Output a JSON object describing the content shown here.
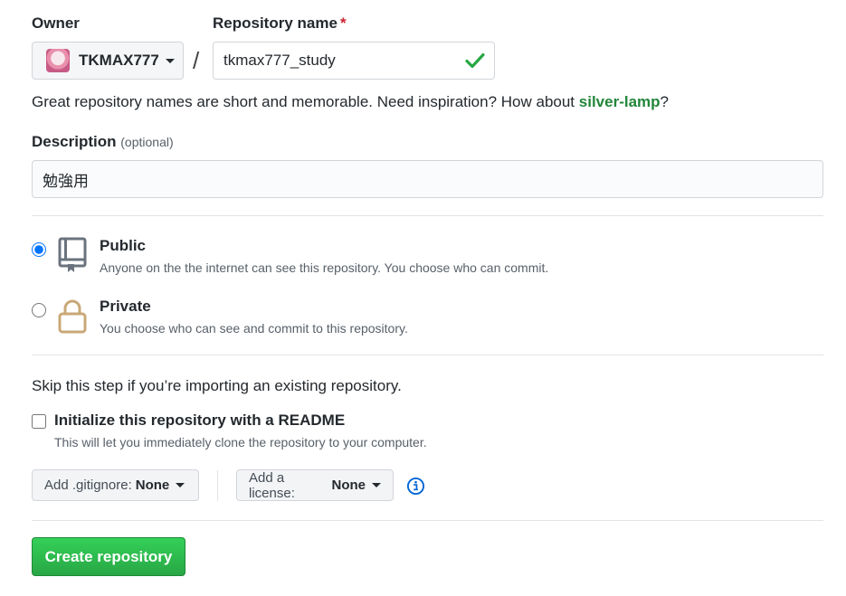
{
  "owner": {
    "label": "Owner",
    "value": "TKMAX777"
  },
  "separator": "/",
  "repo_name": {
    "label": "Repository name",
    "required_mark": "*",
    "value": "tkmax777_study"
  },
  "name_hint": {
    "prefix": "Great repository names are short and memorable. Need inspiration? How about ",
    "suggestion": "silver-lamp",
    "suffix": "?"
  },
  "description": {
    "label": "Description",
    "optional": "(optional)",
    "value": "勉強用"
  },
  "visibility": {
    "public": {
      "title": "Public",
      "desc": "Anyone on the the internet can see this repository. You choose who can commit."
    },
    "private": {
      "title": "Private",
      "desc": "You choose who can see and commit to this repository."
    },
    "selected": "public"
  },
  "skip_note": "Skip this step if you’re importing an existing repository.",
  "readme": {
    "label": "Initialize this repository with a README",
    "desc": "This will let you immediately clone the repository to your computer.",
    "checked": false
  },
  "gitignore": {
    "prefix": "Add .gitignore:",
    "value": "None"
  },
  "license": {
    "prefix": "Add a license:",
    "value": "None"
  },
  "create_button": "Create repository",
  "colors": {
    "accent_green": "#28a745",
    "link_green": "#22863a",
    "required_red": "#cb2431",
    "info_blue": "#0366d6"
  }
}
